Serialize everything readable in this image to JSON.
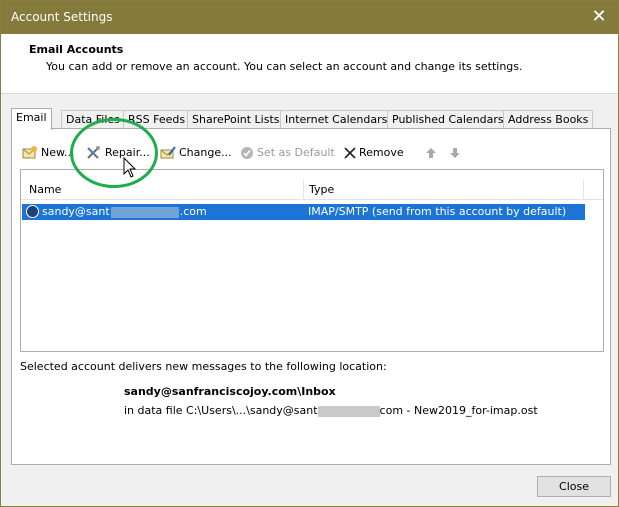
{
  "window": {
    "title": "Account Settings",
    "close_glyph": "✕"
  },
  "header": {
    "title": "Email Accounts",
    "description": "You can add or remove an account. You can select an account and change its settings."
  },
  "tabs": [
    {
      "label": "Email",
      "active": true
    },
    {
      "label": "Data Files",
      "active": false
    },
    {
      "label": "RSS Feeds",
      "active": false
    },
    {
      "label": "SharePoint Lists",
      "active": false
    },
    {
      "label": "Internet Calendars",
      "active": false
    },
    {
      "label": "Published Calendars",
      "active": false
    },
    {
      "label": "Address Books",
      "active": false
    }
  ],
  "toolbar": {
    "new_label": "New...",
    "repair_label": "Repair...",
    "change_label": "Change...",
    "set_default_label": "Set as Default",
    "remove_label": "Remove"
  },
  "list": {
    "col_name": "Name",
    "col_type": "Type",
    "rows": [
      {
        "name_prefix": "sandy@sant",
        "name_suffix": ".com",
        "type": "IMAP/SMTP (send from this account by default)"
      }
    ]
  },
  "delivery": {
    "label": "Selected account delivers new messages to the following location:",
    "inbox": "sandy@sanfranciscojoy.com\\Inbox",
    "file_prefix": "in data file C:\\Users\\...\\sandy@sant",
    "file_suffix": "com - New2019_for-imap.ost"
  },
  "buttons": {
    "close_label": "Close"
  },
  "colors": {
    "titlebar": "#857a3b",
    "selection": "#1c74d6",
    "highlight_circle": "#1fad4c"
  }
}
